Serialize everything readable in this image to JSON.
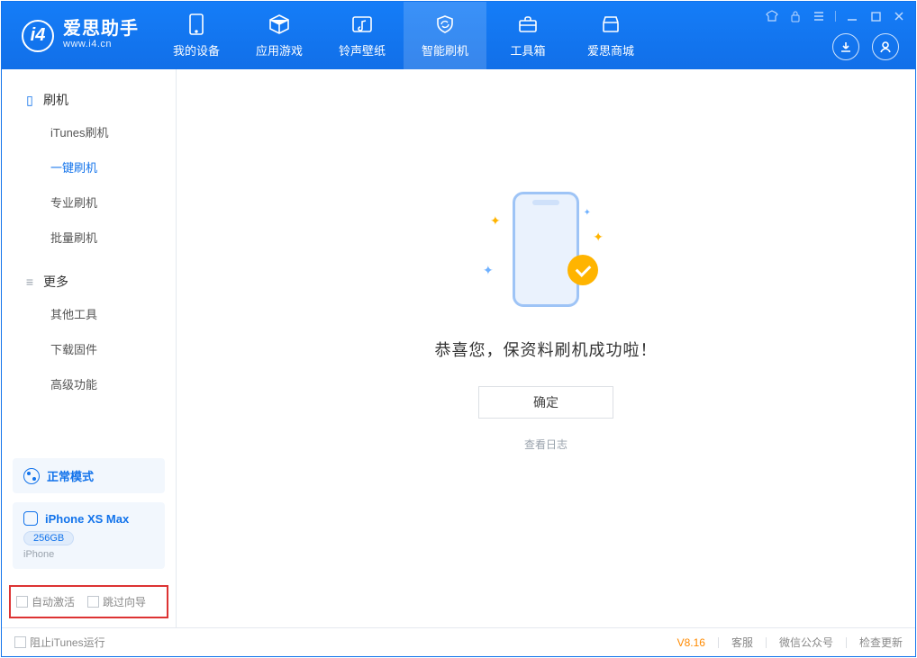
{
  "app": {
    "name_cn": "爱思助手",
    "url": "www.i4.cn"
  },
  "nav": {
    "items": [
      {
        "label": "我的设备"
      },
      {
        "label": "应用游戏"
      },
      {
        "label": "铃声壁纸"
      },
      {
        "label": "智能刷机"
      },
      {
        "label": "工具箱"
      },
      {
        "label": "爱思商城"
      }
    ],
    "active_index": 3
  },
  "sidebar": {
    "section_flash": {
      "title": "刷机",
      "items": [
        {
          "label": "iTunes刷机"
        },
        {
          "label": "一键刷机"
        },
        {
          "label": "专业刷机"
        },
        {
          "label": "批量刷机"
        }
      ],
      "active_index": 1
    },
    "section_more": {
      "title": "更多",
      "items": [
        {
          "label": "其他工具"
        },
        {
          "label": "下载固件"
        },
        {
          "label": "高级功能"
        }
      ]
    },
    "mode_card": {
      "label": "正常模式"
    },
    "device_card": {
      "name": "iPhone XS Max",
      "storage": "256GB",
      "type": "iPhone"
    },
    "checks": {
      "auto_activate": "自动激活",
      "skip_guide": "跳过向导"
    }
  },
  "main": {
    "headline": "恭喜您，保资料刷机成功啦！",
    "ok": "确定",
    "view_log": "查看日志"
  },
  "status": {
    "block_itunes": "阻止iTunes运行",
    "version": "V8.16",
    "support": "客服",
    "wechat": "微信公众号",
    "update": "检查更新"
  }
}
